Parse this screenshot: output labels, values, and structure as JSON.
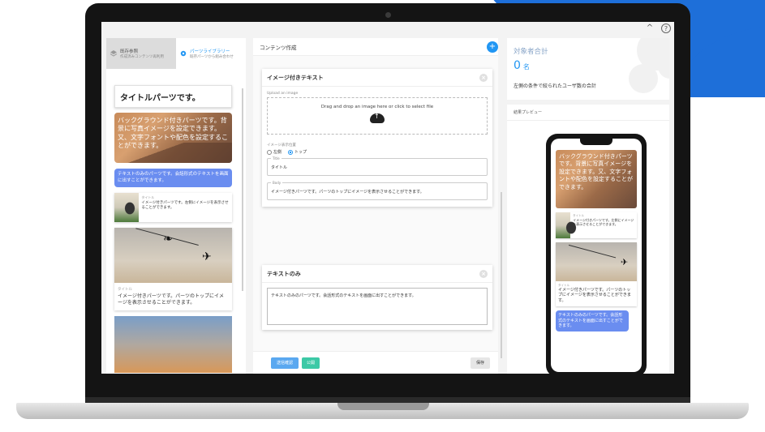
{
  "window": {
    "collapse_glyph": "^",
    "help_glyph": "?"
  },
  "left": {
    "tabs": [
      {
        "title": "既存参照",
        "sub": "作成済みコンテンツ再利用",
        "icon": "layers-icon"
      },
      {
        "title": "パーツライブラリー",
        "sub": "既存パーツから組み合わせ",
        "icon": "gear-icon"
      }
    ],
    "title_part": "タイトルパーツです。",
    "bg_part": "バックグラウンド付きパーツです。背景に写真イメージを設定できます。又、文字フォントや配色を設定することができます。",
    "text_part": "テキストのみのパーツです。会話形式のテキストを画面に出すことができます。",
    "img_left_label": "タイトル",
    "img_left_text": "イメージ付きパーツです。左側にイメージを表示させることができます。",
    "img_top_label": "タイトル",
    "img_top_text": "イメージ付きパーツです。パーツのトップにイメージを表示させることができます。"
  },
  "center": {
    "header": "コンテンツ作成",
    "add_glyph": "+",
    "card1": {
      "title": "イメージ付きテキスト",
      "close_glyph": "×",
      "upload_label": "Upload an image",
      "dropzone_text": "Drag and drop an image here or click to select file",
      "position_label": "イメージ表示位置",
      "radio_left": "左側",
      "radio_top": "トップ",
      "title_legend": "Title",
      "title_value": "タイトル",
      "body_legend": "Body",
      "body_value": "イメージ付きパーツです。パーツのトップにイメージを表示させることができます。"
    },
    "card2": {
      "title": "テキストのみ",
      "close_glyph": "×",
      "text_value": "テキストのみのパーツです。会話形式のテキストを画面に出すことができます。"
    },
    "footer": {
      "send_label": "送信確認",
      "publish_label": "公開",
      "save_label": "保存"
    }
  },
  "right": {
    "total_title": "対象者合計",
    "total_count": "0",
    "total_unit": "名",
    "total_desc": "左側の条件で絞られたユーザ数の合計",
    "preview_title": "結果プレビュー",
    "preview": {
      "bg_text": "バックグラウンド付きパーツです。背景に写真イメージを設定できます。又、文字フォントや配色を設定することができます。",
      "img_left_label": "タイトル",
      "img_left_text": "イメージ付きパーツです。左側にイメージを表示させることができます。",
      "img_top_label": "タイトル",
      "img_top_text": "イメージ付きパーツです。パーツのトップにイメージを表示させることができます。",
      "text_part": "テキストのみのパーツです。会話形式のテキストを画面に出すことができます。"
    }
  },
  "colors": {
    "accent": "#2196f3",
    "publish": "#3cc9a6",
    "text_bubble": "#6a8df0"
  }
}
